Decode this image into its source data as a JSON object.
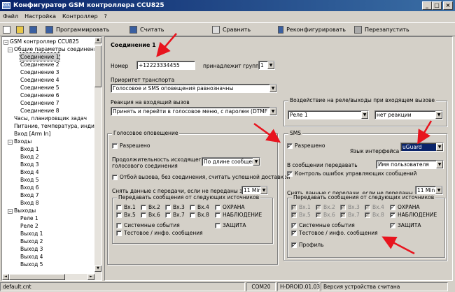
{
  "window": {
    "title": "Конфигуратор GSM контроллера CCU825",
    "icon_text": "CCU",
    "controls": [
      "_",
      "□",
      "×"
    ]
  },
  "menu": [
    "Файл",
    "Настройка",
    "Контроллер",
    "?"
  ],
  "toolbar": {
    "program": "Программировать",
    "read": "Считать",
    "compare": "Сравнить",
    "reconfigure": "Реконфигурировать",
    "restart": "Перезапустить"
  },
  "tree": {
    "root": "GSM контроллер CCU825",
    "general": "Общие параметры соединени",
    "connections": [
      "Соединение 1",
      "Соединение 2",
      "Соединение 3",
      "Соединение 4",
      "Соединение 5",
      "Соединение 6",
      "Соединение 7",
      "Соединение 8"
    ],
    "clock": "Часы, планировщик задач",
    "power": "Питание, температура, индик",
    "arm_input": "Вход [Arm In]",
    "inputs_label": "Входы",
    "inputs": [
      "Вход 1",
      "Вход 2",
      "Вход 3",
      "Вход 4",
      "Вход 5",
      "Вход 6",
      "Вход 7",
      "Вход 8"
    ],
    "outputs_label": "Выходы",
    "outputs": [
      "Реле 1",
      "Реле 2",
      "Выход 1",
      "Выход 2",
      "Выход 3",
      "Выход 4",
      "Выход 5"
    ]
  },
  "form": {
    "heading": "Соединение 1",
    "number_label": "Номер",
    "number_value": "+12223334455",
    "group_label": "принадлежит группе",
    "group_value": "1",
    "priority_label": "Приоритет транспорта",
    "priority_value": "Голосовое и SMS оповещения равнозначны",
    "incoming_label": "Реакция на входящий вызов",
    "incoming_value": "Принять и перейти в голосовое меню, с паролем (DTMF управ",
    "relay_group": {
      "label": "Воздействие на реле/выходы при входящем вызове",
      "relay": "Реле 1",
      "reaction": "нет реакции"
    },
    "voice": {
      "label": "Голосовое оповещение",
      "allowed": "Разрешено",
      "duration_label_1": "Продолжительность исходящего",
      "duration_label_2": "голосового соединения",
      "duration_value": "По длине сообщения",
      "reject_label": "Отбой вызова, без соединения, считать успешной доставкой",
      "remove_label": "Снять данные с передачи, если не переданы за",
      "remove_value": "11 Min.",
      "sources_label": "Передавать сообщения от следующих источников",
      "inputs": [
        "Вх.1",
        "Вх.2",
        "Вх.3",
        "Вх.4",
        "Вх.5",
        "Вх.6",
        "Вх.7",
        "Вх.8"
      ],
      "guard": "ОХРАНА",
      "monitoring": "НАБЛЮДЕНИЕ",
      "system": "Системные события",
      "protection": "ЗАЩИТА",
      "test": "Тестовое / инфо. сообщения"
    },
    "sms": {
      "label": "SMS",
      "allowed": "Разрешено",
      "lang_label": "Язык интерфейса",
      "lang_value": "uGuard",
      "send_label": "В сообщении передавать",
      "send_value": "Имя пользователя",
      "control_label": "Контроль ошибок управляющих сообщений",
      "remove_label": "Снять данные с передачи, если не переданы за",
      "remove_value": "11 Min.",
      "sources_label": "Передавать сообщения от следующих источников",
      "inputs": [
        "Вх.1",
        "Вх.2",
        "Вх.3",
        "Вх.4",
        "Вх.5",
        "Вх.6",
        "Вх.7",
        "Вх.8"
      ],
      "guard": "ОХРАНА",
      "monitoring": "НАБЛЮДЕНИЕ",
      "system": "Системные события",
      "protection": "ЗАЩИТА",
      "test": "Тестовое / инфо. сообщения",
      "profile": "Профиль"
    }
  },
  "status": {
    "file": "default.cnt",
    "port": "COM20",
    "device": "H-DROID.01.03",
    "version_text": "Версия устройства считана"
  }
}
